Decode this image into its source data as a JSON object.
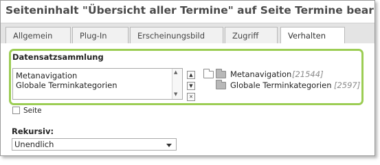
{
  "header": {
    "title": "Seiteninhalt \"Übersicht aller Termine\" auf Seite Termine bearbeiten"
  },
  "tabs": [
    {
      "label": "Allgemein",
      "active": false
    },
    {
      "label": "Plug-In",
      "active": false
    },
    {
      "label": "Erscheinungsbild",
      "active": false
    },
    {
      "label": "Zugriff",
      "active": false
    },
    {
      "label": "Verhalten",
      "active": true
    }
  ],
  "record_storage": {
    "label": "Datensatzsammlung",
    "selected_items": [
      "Metanavigation",
      "Globale Terminkategorien"
    ],
    "tree": [
      {
        "name": "Metanavigation",
        "id": "[21544]",
        "folder": "open"
      },
      {
        "name": "Globale Terminkategorien",
        "id": "[2597]",
        "folder": "closed"
      }
    ],
    "controls": {
      "up": "▲",
      "down": "▼",
      "remove": "✕"
    }
  },
  "page_checkbox": {
    "label": "Seite",
    "checked": false
  },
  "recursive": {
    "label": "Rekursiv:",
    "value": "Unendlich"
  },
  "colors": {
    "highlight": "#9ccd54",
    "tab_bar": "#e4e4e4",
    "id_text": "#8a8a8a"
  }
}
